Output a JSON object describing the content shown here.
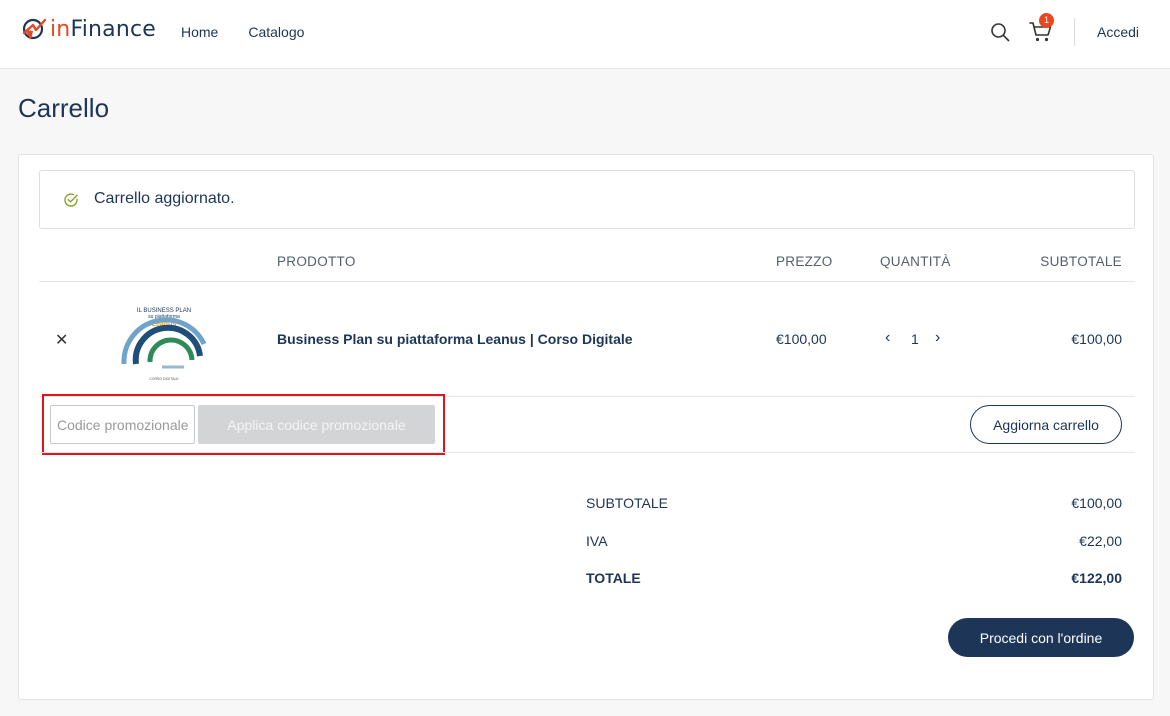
{
  "header": {
    "brand_prefix": "in",
    "brand_suffix": "Finance",
    "nav": [
      "Home",
      "Catalogo"
    ],
    "cart_count": "1",
    "login_label": "Accedi"
  },
  "page": {
    "title": "Carrello"
  },
  "notice": {
    "text": "Carrello aggiornato."
  },
  "table": {
    "headers": {
      "product": "PRODOTTO",
      "price": "PREZZO",
      "quantity": "QUANTITÀ",
      "subtotal": "SUBTOTALE"
    },
    "rows": [
      {
        "remove": "✕",
        "thumb_lines": [
          "IL BUSINESS PLAN",
          "su piattaforma",
          "Leanus",
          "CORSO DIGITALE"
        ],
        "name": "Business Plan su piattaforma Leanus | Corso Digitale",
        "price": "€100,00",
        "quantity": "1",
        "subtotal": "€100,00"
      }
    ]
  },
  "coupon": {
    "placeholder": "Codice promozionale",
    "apply_label": "Applica codice promozionale"
  },
  "update_label": "Aggiorna carrello",
  "totals": {
    "subtotal_label": "SUBTOTALE",
    "subtotal_value": "€100,00",
    "iva_label": "IVA",
    "iva_value": "€22,00",
    "total_label": "TOTALE",
    "total_value": "€122,00"
  },
  "proceed_label": "Procedi con l'ordine",
  "colors": {
    "accent": "#1d3557",
    "brand_orange": "#e8471f",
    "highlight": "#e0141c"
  },
  "icons": {
    "search": "search-icon",
    "cart": "cart-icon",
    "notice": "check-circle-icon"
  }
}
